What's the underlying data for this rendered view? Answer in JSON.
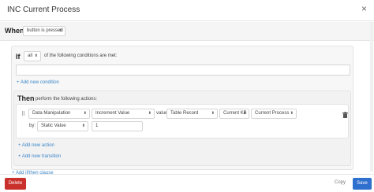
{
  "modal": {
    "title": "INC Current Process",
    "close_symbol": "×"
  },
  "when": {
    "label": "When",
    "trigger": "button is pressed"
  },
  "if_block": {
    "label": "If",
    "mode": "all",
    "suffix": "of the following conditions are met:",
    "condition_value": "",
    "add_condition": "+ Add new condition"
  },
  "then_block": {
    "label": "Then",
    "suffix": "perform the following actions:",
    "action": {
      "type": "Data Manipulation",
      "operation": "Increment Value",
      "value_label": "value:",
      "source": "Table Record",
      "table": "Current KB",
      "field": "Current Process",
      "by_label": "by:",
      "by_type": "Static Value",
      "by_value": "1"
    },
    "add_action": "+ Add new action",
    "add_transition": "+ Add new transition"
  },
  "add_if_then": "+ Add if/then clause",
  "footer": {
    "delete_label": "Delete",
    "copy_label": "Copy",
    "save_label": "Save"
  },
  "icons": {
    "drag": "drag-handle-icon",
    "trash": "trash-icon",
    "caret": "caret-updown-icon"
  },
  "colors": {
    "delete": "#c9302c",
    "save": "#2f6fce",
    "link": "#3a86c8"
  }
}
